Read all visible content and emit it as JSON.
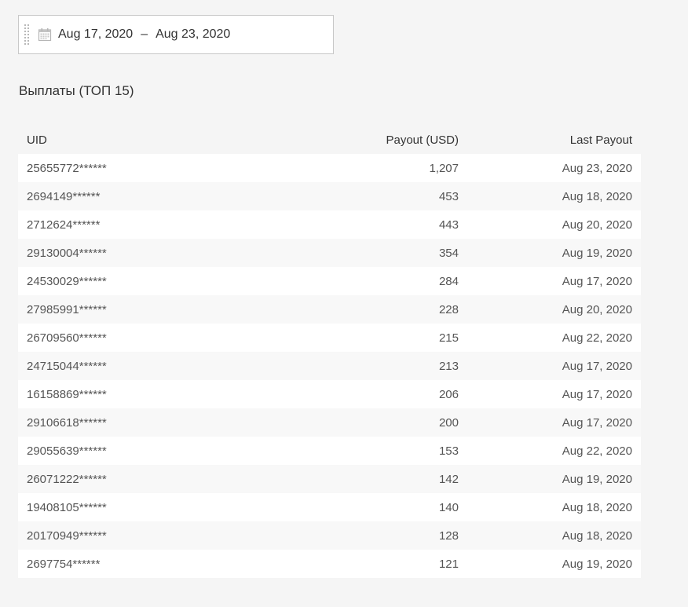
{
  "date_range": {
    "start": "Aug 17, 2020",
    "separator": "–",
    "end": "Aug 23, 2020",
    "icon": "calendar-icon"
  },
  "section": {
    "title": "Выплаты (ТОП 15)"
  },
  "table": {
    "headers": {
      "uid": "UID",
      "payout": "Payout (USD)",
      "last_payout": "Last Payout"
    },
    "rows": [
      {
        "uid": "25655772******",
        "payout": "1,207",
        "last": "Aug 23, 2020"
      },
      {
        "uid": "2694149******",
        "payout": "453",
        "last": "Aug 18, 2020"
      },
      {
        "uid": "2712624******",
        "payout": "443",
        "last": "Aug 20, 2020"
      },
      {
        "uid": "29130004******",
        "payout": "354",
        "last": "Aug 19, 2020"
      },
      {
        "uid": "24530029******",
        "payout": "284",
        "last": "Aug 17, 2020"
      },
      {
        "uid": "27985991******",
        "payout": "228",
        "last": "Aug 20, 2020"
      },
      {
        "uid": "26709560******",
        "payout": "215",
        "last": "Aug 22, 2020"
      },
      {
        "uid": "24715044******",
        "payout": "213",
        "last": "Aug 17, 2020"
      },
      {
        "uid": "16158869******",
        "payout": "206",
        "last": "Aug 17, 2020"
      },
      {
        "uid": "29106618******",
        "payout": "200",
        "last": "Aug 17, 2020"
      },
      {
        "uid": "29055639******",
        "payout": "153",
        "last": "Aug 22, 2020"
      },
      {
        "uid": "26071222******",
        "payout": "142",
        "last": "Aug 19, 2020"
      },
      {
        "uid": "19408105******",
        "payout": "140",
        "last": "Aug 18, 2020"
      },
      {
        "uid": "20170949******",
        "payout": "128",
        "last": "Aug 18, 2020"
      },
      {
        "uid": "2697754******",
        "payout": "121",
        "last": "Aug 19, 2020"
      }
    ]
  }
}
